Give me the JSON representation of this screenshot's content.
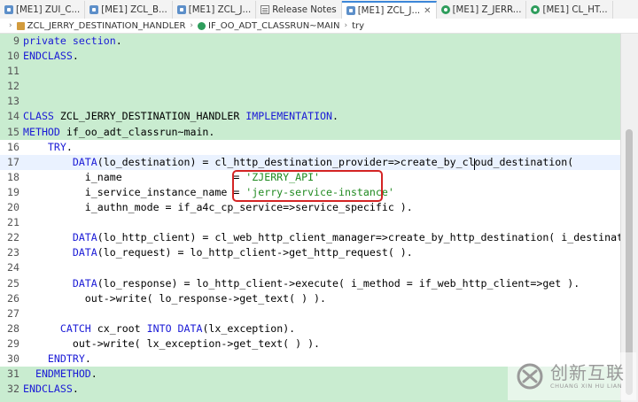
{
  "tabs": [
    {
      "label": "[ME1] ZUI_C...",
      "icon": "abap-object-icon",
      "active": false
    },
    {
      "label": "[ME1] ZCL_B...",
      "icon": "abap-object-icon",
      "active": false
    },
    {
      "label": "[ME1] ZCL_J...",
      "icon": "abap-object-icon",
      "active": false
    },
    {
      "label": "Release Notes",
      "icon": "release-notes-icon",
      "active": false
    },
    {
      "label": "[ME1] ZCL_J...",
      "icon": "abap-object-icon",
      "active": true
    },
    {
      "label": "[ME1] Z_JERR...",
      "icon": "abap-class-icon",
      "active": false
    },
    {
      "label": "[ME1] CL_HT...",
      "icon": "abap-class-icon",
      "active": false
    }
  ],
  "breadcrumb": {
    "class_name": "ZCL_JERRY_DESTINATION_HANDLER",
    "method_name": "IF_OO_ADT_CLASSRUN~MAIN",
    "block_name": "try"
  },
  "code_lines": [
    {
      "n": "9",
      "text": "private section."
    },
    {
      "n": "10",
      "text": "ENDCLASS."
    },
    {
      "n": "11",
      "text": ""
    },
    {
      "n": "12",
      "text": ""
    },
    {
      "n": "13",
      "text": ""
    },
    {
      "n": "14",
      "text": "CLASS ZCL_JERRY_DESTINATION_HANDLER IMPLEMENTATION."
    },
    {
      "n": "15",
      "text": "METHOD if_oo_adt_classrun~main."
    },
    {
      "n": "16",
      "text": "    TRY."
    },
    {
      "n": "17",
      "text": "        DATA(lo_destination) = cl_http_destination_provider=>create_by_cloud_destination("
    },
    {
      "n": "18",
      "text": "          i_name                  = 'ZJERRY_API'"
    },
    {
      "n": "19",
      "text": "          i_service_instance_name = 'jerry-service-instance'"
    },
    {
      "n": "20",
      "text": "          i_authn_mode = if_a4c_cp_service=>service_specific )."
    },
    {
      "n": "21",
      "text": ""
    },
    {
      "n": "22",
      "text": "        DATA(lo_http_client) = cl_web_http_client_manager=>create_by_http_destination( i_destination"
    },
    {
      "n": "23",
      "text": "        DATA(lo_request) = lo_http_client->get_http_request( )."
    },
    {
      "n": "24",
      "text": ""
    },
    {
      "n": "25",
      "text": "        DATA(lo_response) = lo_http_client->execute( i_method = if_web_http_client=>get )."
    },
    {
      "n": "26",
      "text": "          out->write( lo_response->get_text( ) )."
    },
    {
      "n": "27",
      "text": ""
    },
    {
      "n": "28",
      "text": "      CATCH cx_root INTO DATA(lx_exception)."
    },
    {
      "n": "29",
      "text": "        out->write( lx_exception->get_text( ) )."
    },
    {
      "n": "30",
      "text": "    ENDTRY."
    },
    {
      "n": "31",
      "text": "  ENDMETHOD."
    },
    {
      "n": "32",
      "text": "ENDCLASS."
    }
  ],
  "watermark": {
    "name_cn": "创新互联",
    "name_en": "CHUANG XIN HU LIAN"
  },
  "colors": {
    "code_background": "#c9ecd0",
    "keyword": "#1a1ad6",
    "string": "#208a20",
    "highlight_box": "#d42424",
    "active_tab_accent": "#3b86d8"
  }
}
